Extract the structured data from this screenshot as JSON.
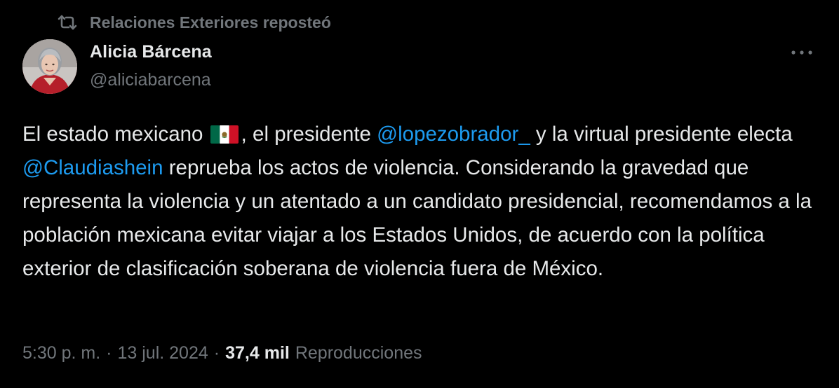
{
  "repost": {
    "icon": "repost-icon",
    "text": "Relaciones Exteriores reposteó"
  },
  "author": {
    "name": "Alicia Bárcena",
    "handle": "@aliciabarcena"
  },
  "menu": {
    "icon": "more-horizontal-icon"
  },
  "tweet": {
    "segments": [
      {
        "type": "text",
        "value": "El estado mexicano "
      },
      {
        "type": "flag",
        "value": "🇲🇽"
      },
      {
        "type": "text",
        "value": ", el presidente "
      },
      {
        "type": "mention",
        "value": "@lopezobrador_"
      },
      {
        "type": "text",
        "value": " y la virtual presidente electa "
      },
      {
        "type": "mention",
        "value": "@Claudiashein"
      },
      {
        "type": "text",
        "value": " reprueba los actos de violencia. Considerando la gravedad que representa la violencia y un atentado a un candidato presidencial, recomendamos a la población mexicana evitar viajar a los Estados Unidos, de acuerdo con la política exterior de clasificación soberana de violencia fuera de México."
      }
    ]
  },
  "meta": {
    "time": "5:30 p. m.",
    "separator": "·",
    "date": "13 jul. 2024",
    "views_count": "37,4 mil",
    "views_label": "Reproducciones"
  },
  "colors": {
    "background": "#000000",
    "text": "#e7e9ea",
    "secondary": "#71767b",
    "mention": "#1d9bf0",
    "flag_green": "#006847",
    "flag_red": "#ce1126"
  }
}
